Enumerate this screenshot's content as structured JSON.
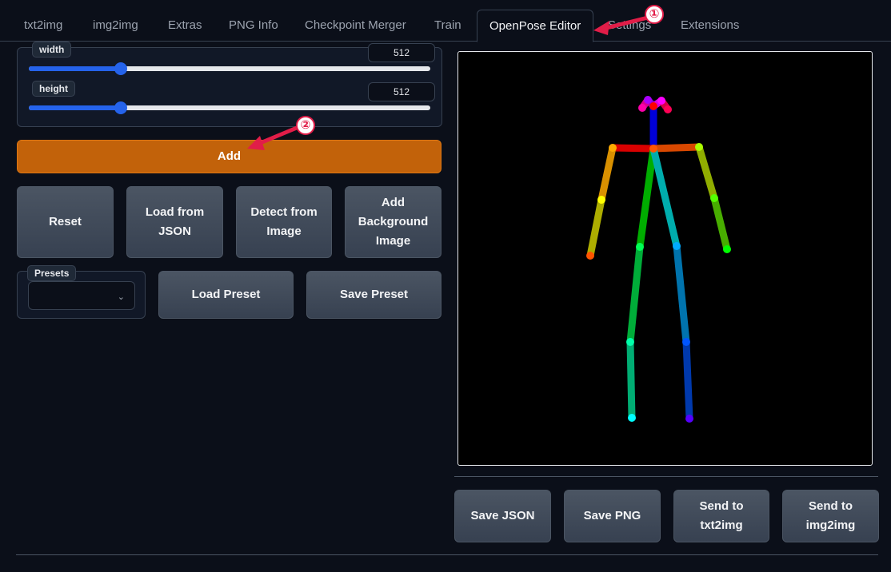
{
  "tabs": [
    {
      "label": "txt2img"
    },
    {
      "label": "img2img"
    },
    {
      "label": "Extras"
    },
    {
      "label": "PNG Info"
    },
    {
      "label": "Checkpoint Merger"
    },
    {
      "label": "Train"
    },
    {
      "label": "OpenPose Editor",
      "active": true
    },
    {
      "label": "Settings"
    },
    {
      "label": "Extensions"
    }
  ],
  "dimensions": {
    "width": {
      "label": "width",
      "value": "512",
      "fraction": 0.23
    },
    "height": {
      "label": "height",
      "value": "512",
      "fraction": 0.23
    }
  },
  "buttons": {
    "add": "Add",
    "reset": "Reset",
    "load_json": "Load from\nJSON",
    "detect": "Detect from\nImage",
    "add_bg": "Add\nBackground\nImage",
    "load_preset": "Load Preset",
    "save_preset": "Save Preset",
    "save_json": "Save JSON",
    "save_png": "Save PNG",
    "send_txt2img": "Send to\ntxt2img",
    "send_img2img": "Send to\nimg2img"
  },
  "presets": {
    "label": "Presets",
    "value": ""
  },
  "annotations": {
    "one": "①",
    "two": "②"
  },
  "colors": {
    "accent": "#c2620a",
    "slider": "#2563eb",
    "annotation": "#e11d48"
  }
}
